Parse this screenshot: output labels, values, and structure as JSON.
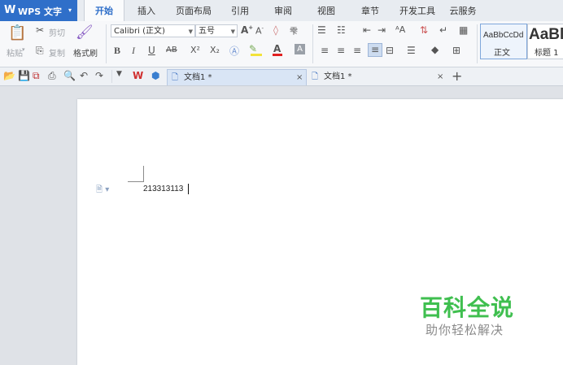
{
  "app": {
    "logo": "W",
    "name": "WPS 文字",
    "caret": "▾"
  },
  "menu_tabs": [
    {
      "label": "开始",
      "active": true
    },
    {
      "label": "插入"
    },
    {
      "label": "页面布局"
    },
    {
      "label": "引用"
    },
    {
      "label": "审阅"
    },
    {
      "label": "视图"
    },
    {
      "label": "章节"
    },
    {
      "label": "开发工具"
    },
    {
      "label": "云服务"
    }
  ],
  "clipboard": {
    "paste": "粘贴",
    "cut": "剪切",
    "copy": "复制",
    "format_painter": "格式刷"
  },
  "font": {
    "name": "Calibri (正文)",
    "size": "五号"
  },
  "styles": {
    "normal_preview": "AaBbCcDd",
    "normal_label": "正文",
    "heading_preview": "AaBl",
    "heading_label": "标题 1"
  },
  "format_buttons": {
    "bold": "B",
    "italic": "I",
    "underline": "U",
    "strike": "AB",
    "superscript": "X²",
    "subscript": "X₂"
  },
  "doc_tabs": [
    {
      "label": "文档1 *",
      "active": true
    },
    {
      "label": "文档1 *"
    }
  ],
  "document": {
    "text": "213313113"
  },
  "watermark": {
    "title": "百科全说",
    "subtitle": "助你轻松解决"
  }
}
